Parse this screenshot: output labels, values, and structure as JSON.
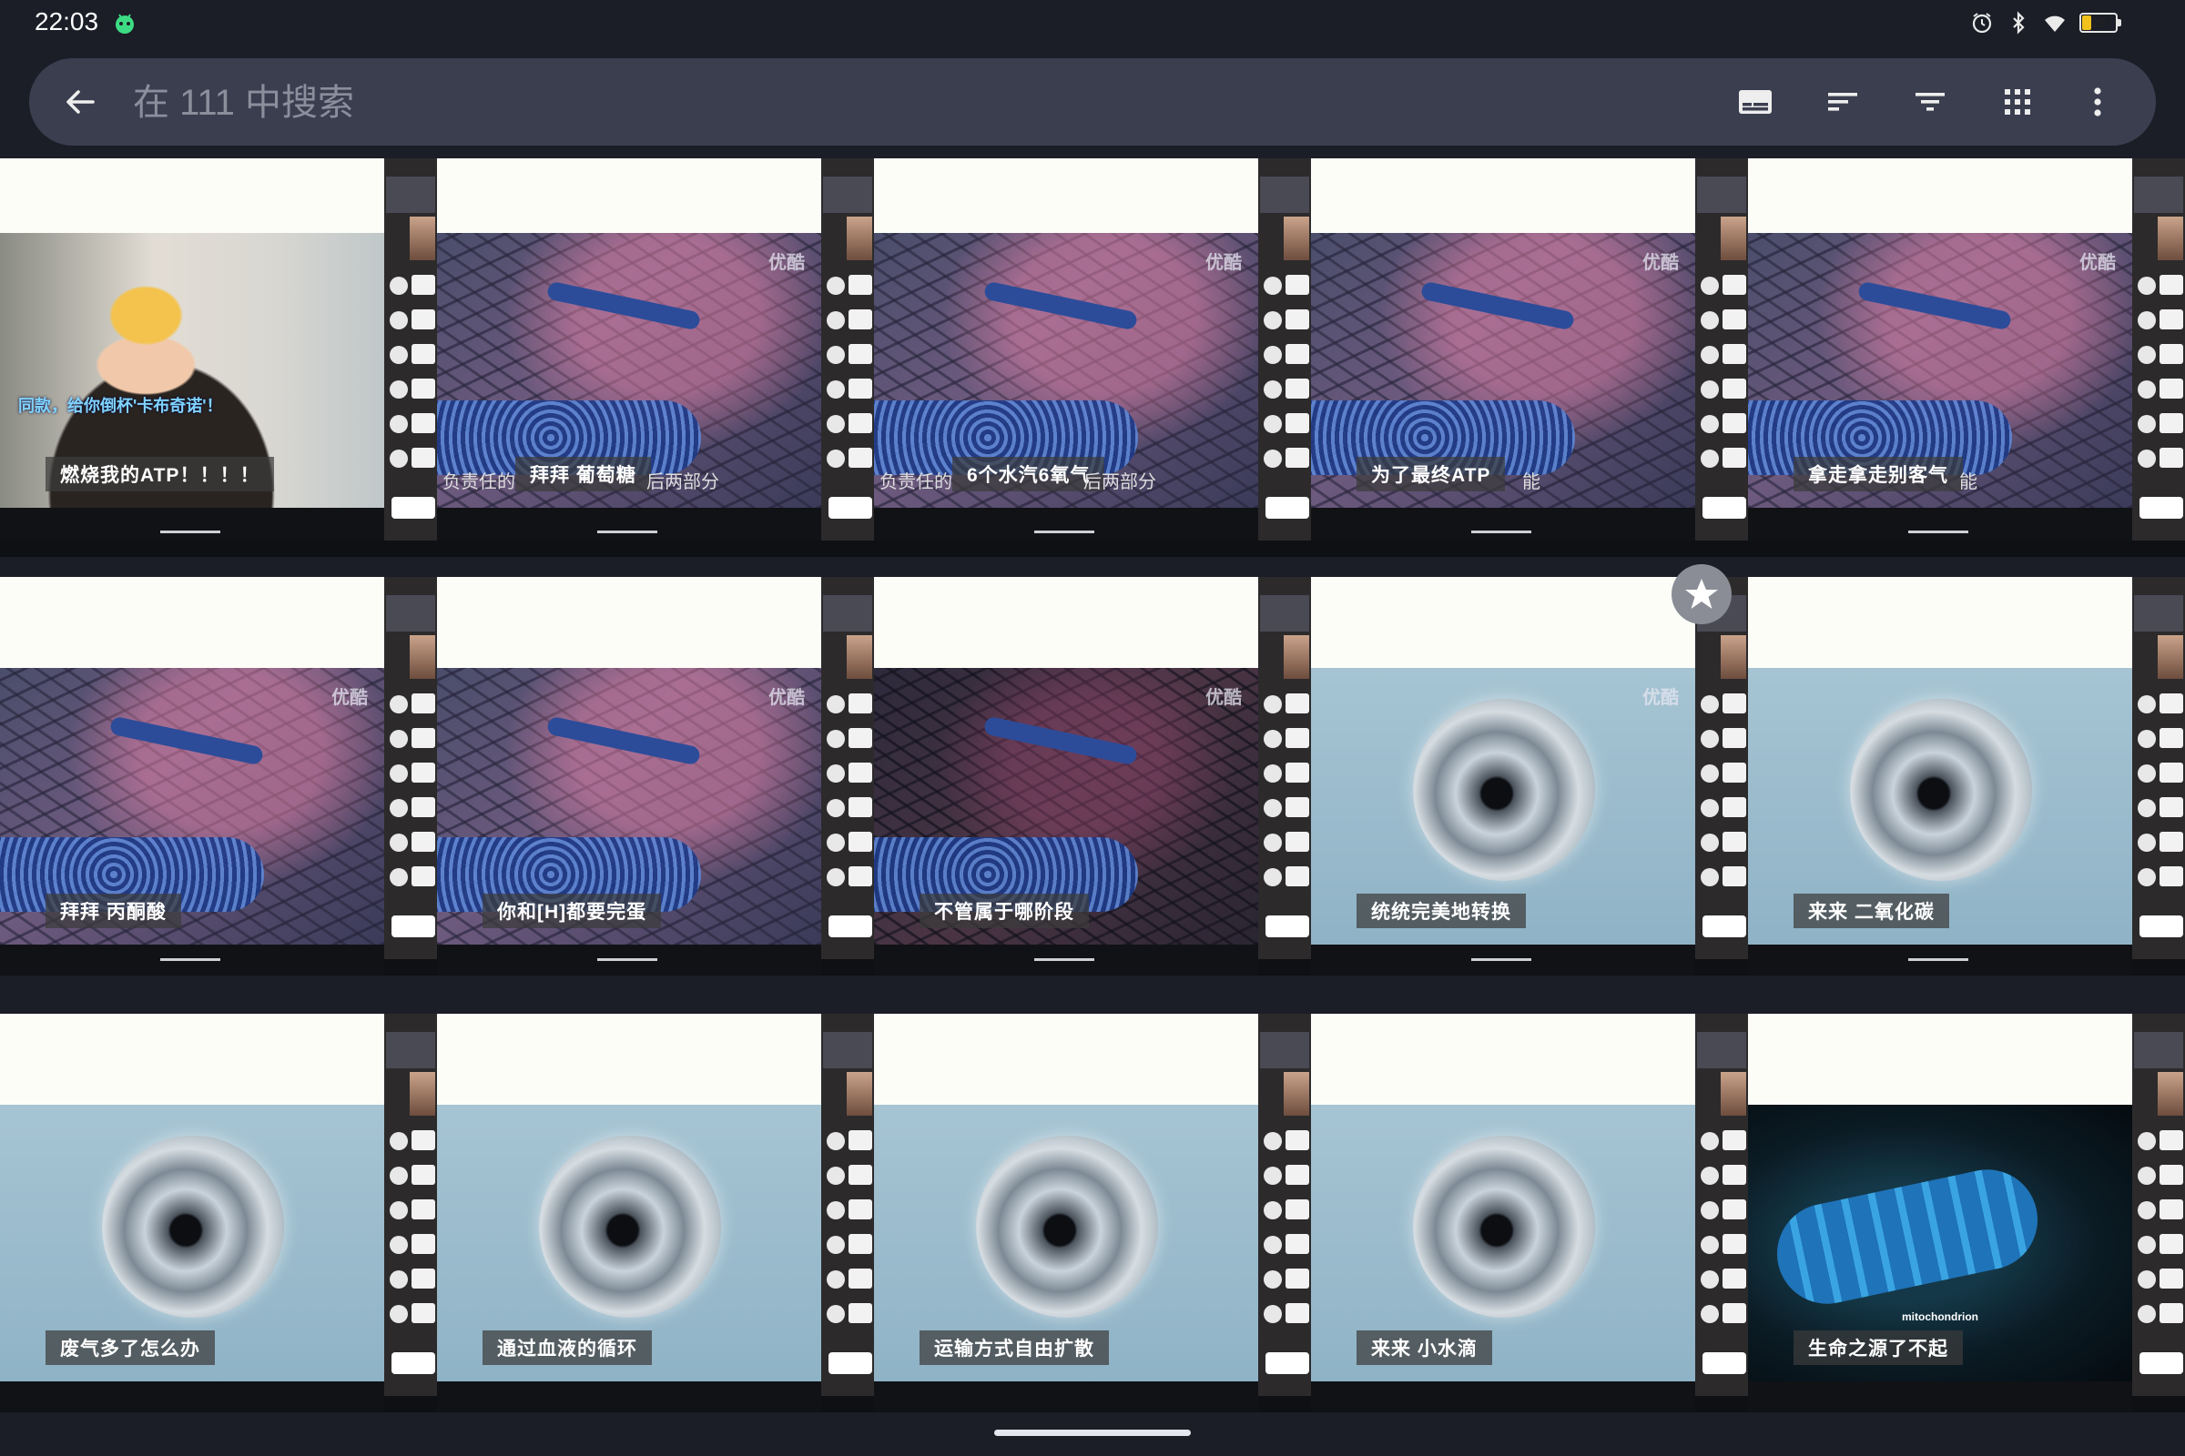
{
  "status_bar": {
    "time": "22:03",
    "app_icon": "android-robot-icon",
    "icons": [
      "alarm-icon",
      "bluetooth-icon",
      "wifi-icon",
      "battery-icon"
    ],
    "battery_level": "29",
    "battery_fraction": 0.29,
    "battery_color": "#f1c21b"
  },
  "search": {
    "placeholder": "在 111 中搜索",
    "value": ""
  },
  "toolbar": {
    "actions": [
      "subtitles-icon",
      "sort-icon",
      "filter-icon",
      "grid-view-icon",
      "more-options-icon"
    ]
  },
  "grid": {
    "tiles": [
      {
        "caption": "燃烧我的ATP！！！！",
        "overlay": "同款，给你倒杯'卡布奇诺'！",
        "scene": "selfie",
        "watermark": ""
      },
      {
        "caption": "拜拜 葡萄糖",
        "caption_left": "负责任的",
        "caption_right": "后两部分",
        "scene": "bacteria",
        "watermark": "优酷"
      },
      {
        "caption": "6个水汽6氧气",
        "caption_left": "负责任的",
        "caption_right": "后两部分",
        "scene": "bacteria",
        "watermark": "优酷"
      },
      {
        "caption": "为了最终ATP",
        "caption_right": "能",
        "scene": "bacteria",
        "watermark": "优酷"
      },
      {
        "caption": "拿走拿走别客气",
        "caption_right": "能",
        "scene": "bacteria",
        "watermark": "优酷"
      },
      {
        "caption": "拜拜 丙酮酸",
        "scene": "bacteria",
        "watermark": "优酷"
      },
      {
        "caption": "你和[H]都要完蛋",
        "scene": "bacteria",
        "watermark": "优酷"
      },
      {
        "caption": "不管属于哪阶段",
        "scene": "bacteria-dark",
        "watermark": "优酷"
      },
      {
        "caption": "统统完美地转换",
        "scene": "cell",
        "watermark": "优酷",
        "starred": true
      },
      {
        "caption": "来来 二氧化碳",
        "scene": "cell",
        "watermark": ""
      },
      {
        "caption": "废气多了怎么办",
        "scene": "cell",
        "watermark": ""
      },
      {
        "caption": "通过血液的循环",
        "scene": "cell",
        "watermark": ""
      },
      {
        "caption": "运输方式自由扩散",
        "scene": "cell",
        "watermark": ""
      },
      {
        "caption": "来来 小水滴",
        "scene": "cell",
        "watermark": ""
      },
      {
        "caption": "生命之源了不起",
        "scene": "mitochondrion",
        "watermark": "",
        "label": "mitochondrion"
      }
    ]
  },
  "overlay": {
    "star_icon": "star-icon"
  }
}
